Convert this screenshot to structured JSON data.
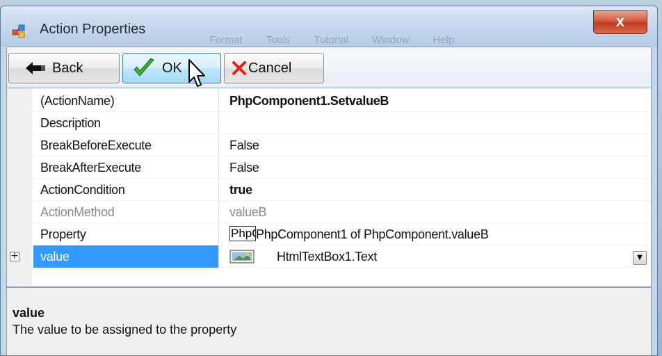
{
  "window": {
    "title": "Action Properties",
    "close_label": "x",
    "menu_ghost": [
      "Format",
      "Tools",
      "Tutorial",
      "Window",
      "Help"
    ]
  },
  "toolbar": {
    "back_label": "Back",
    "ok_label": "OK",
    "cancel_label": "Cancel"
  },
  "properties": {
    "rows": [
      {
        "name": "(ActionName)",
        "value": "PhpComponent1.SetvalueB"
      },
      {
        "name": "Description",
        "value": ""
      },
      {
        "name": "BreakBeforeExecute",
        "value": "False"
      },
      {
        "name": "BreakAfterExecute",
        "value": "False"
      },
      {
        "name": "ActionCondition",
        "value": "true"
      },
      {
        "name": "ActionMethod",
        "value": "valueB"
      },
      {
        "name": "Property",
        "value_box": "PhpC",
        "value": "PhpComponent1 of PhpComponent.valueB"
      },
      {
        "name": "value",
        "value": "HtmlTextBox1.Text",
        "expand": "+",
        "dropdown": "▼"
      }
    ]
  },
  "help": {
    "title": "value",
    "description": "The value to be assigned to the property"
  },
  "colors": {
    "selection": "#3399ff",
    "title_text": "#1e2a3a",
    "close_red": "#c2381e"
  }
}
